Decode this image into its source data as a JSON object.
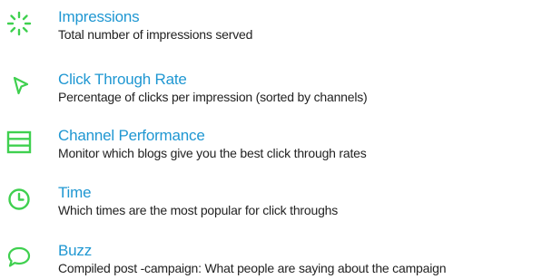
{
  "accent_color": "#3fd04f",
  "title_color": "#1f97d2",
  "text_color": "#222222",
  "features": [
    {
      "icon": "spinner-icon",
      "title": "Impressions",
      "description": "Total number of impressions served"
    },
    {
      "icon": "cursor-icon",
      "title": "Click Through Rate",
      "description": "Percentage of clicks per impression (sorted by channels)"
    },
    {
      "icon": "list-icon",
      "title": "Channel Performance",
      "description": "Monitor which blogs give you the best click through rates"
    },
    {
      "icon": "clock-icon",
      "title": "Time",
      "description": "Which times are the most popular for click throughs"
    },
    {
      "icon": "speech-bubble-icon",
      "title": "Buzz",
      "description": "Compiled post -campaign: What people are saying about the campaign"
    }
  ]
}
